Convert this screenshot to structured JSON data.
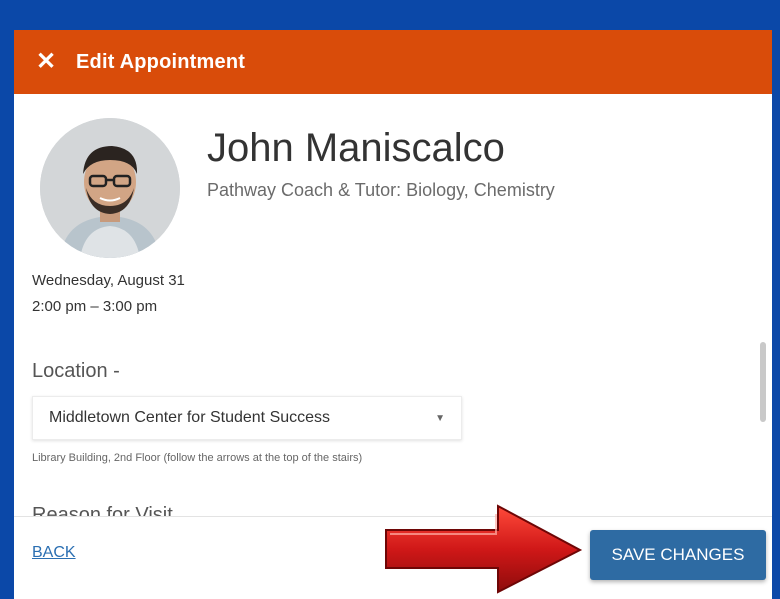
{
  "dialog": {
    "title": "Edit Appointment",
    "close_icon": "close-icon",
    "close_glyph": "✕"
  },
  "profile": {
    "name": "John Maniscalco",
    "role": "Pathway Coach & Tutor: Biology, Chemistry"
  },
  "appointment": {
    "date": "Wednesday, August 31",
    "time": "2:00 pm – 3:00 pm"
  },
  "location": {
    "label": "Location -",
    "selected": "Middletown Center for Student Success",
    "caret_glyph": "▼",
    "help": "Library Building, 2nd Floor (follow the arrows at the top of the stairs)"
  },
  "reason": {
    "label": "Reason for Visit"
  },
  "footer": {
    "back_label": "BACK",
    "save_label": "SAVE CHANGES"
  },
  "colors": {
    "header": "#d94c0a",
    "frame": "#0b48a8",
    "save_button": "#2e6ba3",
    "annotation_arrow": "#d01818"
  }
}
